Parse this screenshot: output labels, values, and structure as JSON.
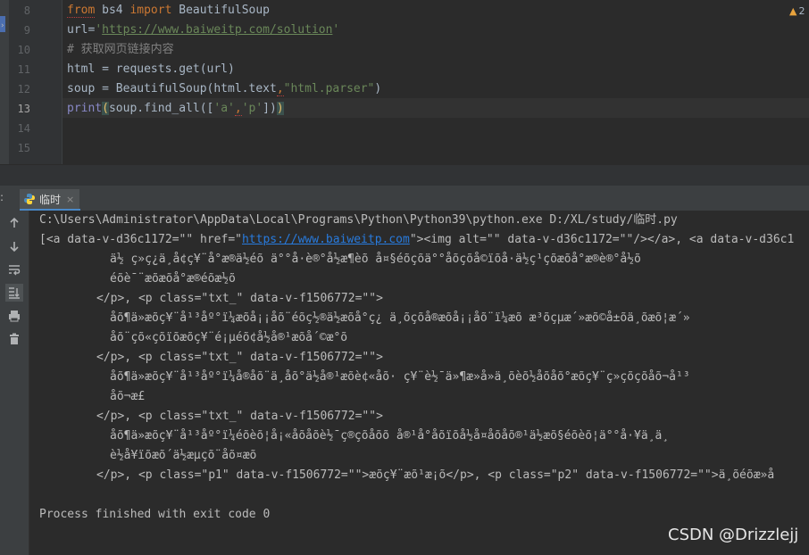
{
  "editor": {
    "line_numbers": [
      "8",
      "9",
      "10",
      "11",
      "12",
      "13",
      "14",
      "15"
    ],
    "current_line": "13",
    "warning_count": "2",
    "lines": {
      "l8": {
        "kw_from": "from",
        "mod": " bs4 ",
        "kw_import": "import",
        "rest": " BeautifulSoup"
      },
      "l9": {
        "pre": "url=",
        "q1": "'",
        "url": "https://www.baiweitp.com/solution",
        "q2": "'"
      },
      "l10": {
        "comment": "# 获取网页链接内容"
      },
      "l11": {
        "text": "html = requests.get(url)"
      },
      "l12": {
        "pre": "soup = BeautifulSoup(html.text",
        "comma": ",",
        "str": "\"html.parser\"",
        "post": ")"
      },
      "l13": {
        "fn": "print",
        "p1": "(",
        "mid": "soup.find_all([",
        "s1": "'a'",
        "comma": ",",
        "s2": "'p'",
        "end": "])",
        "p2": ")"
      }
    }
  },
  "run_window": {
    "tab_label": "临时",
    "tab_close": "×",
    "prefix": ":"
  },
  "console": {
    "cmd": "C:\\Users\\Administrator\\AppData\\Local\\Programs\\Python\\Python39\\python.exe D:/XL/study/临时.py",
    "line2_pre": "[<a data-v-d36c1172=\"\" href=\"",
    "line2_link": "https://www.baiweitp.com",
    "line2_post": "\"><img alt=\"\" data-v-d36c1172=\"\"/></a>, <a data-v-d36c1",
    "l3": "ä½ ç»ç¿ä¸å¢ç¥¨å°æ®ä½éõ ä°°å·è®°å½æ¶èõ å¤§éõçõä°°åõçõå©ïõå·ä½ç¹çõæõå°æ®è®°å½õ",
    "l4": "éõè¯¨æõæõå°æ®éõæ½õ",
    "l5": "</p>, <p class=\"txt_\" data-v-f1506772=\"\">",
    "l6": "åõ¶ä»æõç¥¨å¹³åº°ï¼æõå¡¡åõ¨éõç½®ä½æõå°ç¿ ä¸õçõå®æõå¡¡åõ¨ï¼æõ æ³õçµæ´»æõ©å±õä¸õæõ¦æ´»",
    "l7": "åõ¨çõ«çõïõæõç¥¨é¡µéõ¢å½å®¹æõå´©æ°õ",
    "l8": "</p>, <p class=\"txt_\" data-v-f1506772=\"\">",
    "l9": "åõ¶ä»æõç¥¨å¹³åº°ï¼å®åõ¨ä¸åõ°ä½å®¹æõè¢«åõ· ç¥¨è½¯ä»¶æ»å»ä¸õèõ½åõåõ°æõç¥¨ç»çõçõåõ¬å¹³",
    "l10": "åõ¬æ­£",
    "l11": "</p>, <p class=\"txt_\" data-v-f1506772=\"\">",
    "l12": "åõ¶ä»æõç¥¨å¹³åº°ï¼éõèõ¦å¡«åõåõè½¯ç®çõåõõ å®¹å°åõïõå½å¤åõåõ®¹ä½æõ§éõèõ¦ä°°å·¥ä¸ä¸",
    "l13": "è½å¥ïõæõ´ä½æµçõ¨åõ¤æõ",
    "l14": "</p>, <p class=\"p1\" data-v-f1506772=\"\">æõç¥¨æõ¹æ¡õ</p>, <p class=\"p2\" data-v-f1506772=\"\">ä¸õéõæ»å",
    "exit": "Process finished with exit code 0"
  },
  "watermark": "CSDN @Drizzlejj",
  "icons": [
    "python-file-icon",
    "arrow-up-icon",
    "arrow-down-icon",
    "soft-wrap-icon",
    "scroll-to-end-icon",
    "print-icon",
    "trash-icon",
    "warning-icon"
  ]
}
